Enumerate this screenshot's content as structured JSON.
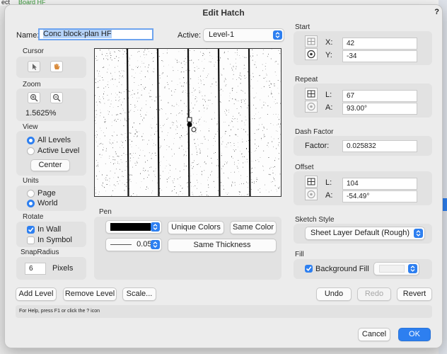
{
  "background": {
    "left_text": "ect",
    "tab_text": "Board HF"
  },
  "dialog": {
    "title": "Edit Hatch",
    "help_mark": "?"
  },
  "name": {
    "label": "Name:",
    "value": "Conc block-plan HF"
  },
  "active": {
    "label": "Active:",
    "value": "Level-1"
  },
  "cursor": {
    "title": "Cursor"
  },
  "zoom": {
    "title": "Zoom",
    "value": "1.5625%"
  },
  "view": {
    "title": "View",
    "options": [
      "All Levels",
      "Active Level"
    ],
    "selected": "All Levels",
    "center_label": "Center"
  },
  "units": {
    "title": "Units",
    "options": [
      "Page",
      "World"
    ],
    "selected": "World"
  },
  "rotate": {
    "title": "Rotate",
    "in_wall": "In Wall",
    "in_wall_checked": true,
    "in_symbol": "In Symbol",
    "in_symbol_checked": false
  },
  "snap": {
    "title": "SnapRadius",
    "value": "6",
    "unit": "Pixels"
  },
  "pen": {
    "title": "Pen",
    "color": "#000000",
    "thickness": "0.05",
    "unique_colors": "Unique Colors",
    "same_color": "Same Color",
    "same_thickness": "Same Thickness"
  },
  "start": {
    "title": "Start",
    "x_label": "X:",
    "x": "42",
    "y_label": "Y:",
    "y": "-34"
  },
  "repeat": {
    "title": "Repeat",
    "l_label": "L:",
    "l": "67",
    "a_label": "A:",
    "a": "93.00°"
  },
  "dash": {
    "title": "Dash Factor",
    "label": "Factor:",
    "value": "0.025832"
  },
  "offset": {
    "title": "Offset",
    "l_label": "L:",
    "l": "104",
    "a_label": "A:",
    "a": "-54.49°"
  },
  "sketch": {
    "title": "Sketch Style",
    "value": "Sheet Layer Default (Rough)"
  },
  "fill": {
    "title": "Fill",
    "label": "Background Fill",
    "checked": true
  },
  "buttons": {
    "add_level": "Add Level",
    "remove_level": "Remove Level",
    "scale": "Scale...",
    "undo": "Undo",
    "redo": "Redo",
    "revert": "Revert",
    "cancel": "Cancel",
    "ok": "OK"
  },
  "help_text": "For Help, press F1 or click the ? icon",
  "colors": {
    "accent": "#2d7ff0",
    "panel": "#e2e2e2",
    "window": "#ececec"
  }
}
